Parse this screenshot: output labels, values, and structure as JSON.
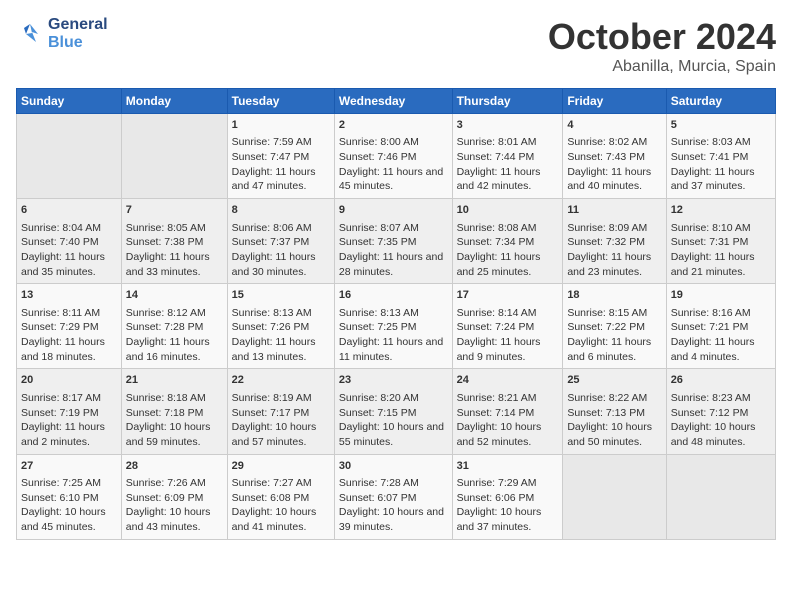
{
  "header": {
    "logo_line1": "General",
    "logo_line2": "Blue",
    "month": "October 2024",
    "location": "Abanilla, Murcia, Spain"
  },
  "days_of_week": [
    "Sunday",
    "Monday",
    "Tuesday",
    "Wednesday",
    "Thursday",
    "Friday",
    "Saturday"
  ],
  "weeks": [
    [
      {
        "day": "",
        "info": ""
      },
      {
        "day": "",
        "info": ""
      },
      {
        "day": "1",
        "info": "Sunrise: 7:59 AM\nSunset: 7:47 PM\nDaylight: 11 hours and 47 minutes."
      },
      {
        "day": "2",
        "info": "Sunrise: 8:00 AM\nSunset: 7:46 PM\nDaylight: 11 hours and 45 minutes."
      },
      {
        "day": "3",
        "info": "Sunrise: 8:01 AM\nSunset: 7:44 PM\nDaylight: 11 hours and 42 minutes."
      },
      {
        "day": "4",
        "info": "Sunrise: 8:02 AM\nSunset: 7:43 PM\nDaylight: 11 hours and 40 minutes."
      },
      {
        "day": "5",
        "info": "Sunrise: 8:03 AM\nSunset: 7:41 PM\nDaylight: 11 hours and 37 minutes."
      }
    ],
    [
      {
        "day": "6",
        "info": "Sunrise: 8:04 AM\nSunset: 7:40 PM\nDaylight: 11 hours and 35 minutes."
      },
      {
        "day": "7",
        "info": "Sunrise: 8:05 AM\nSunset: 7:38 PM\nDaylight: 11 hours and 33 minutes."
      },
      {
        "day": "8",
        "info": "Sunrise: 8:06 AM\nSunset: 7:37 PM\nDaylight: 11 hours and 30 minutes."
      },
      {
        "day": "9",
        "info": "Sunrise: 8:07 AM\nSunset: 7:35 PM\nDaylight: 11 hours and 28 minutes."
      },
      {
        "day": "10",
        "info": "Sunrise: 8:08 AM\nSunset: 7:34 PM\nDaylight: 11 hours and 25 minutes."
      },
      {
        "day": "11",
        "info": "Sunrise: 8:09 AM\nSunset: 7:32 PM\nDaylight: 11 hours and 23 minutes."
      },
      {
        "day": "12",
        "info": "Sunrise: 8:10 AM\nSunset: 7:31 PM\nDaylight: 11 hours and 21 minutes."
      }
    ],
    [
      {
        "day": "13",
        "info": "Sunrise: 8:11 AM\nSunset: 7:29 PM\nDaylight: 11 hours and 18 minutes."
      },
      {
        "day": "14",
        "info": "Sunrise: 8:12 AM\nSunset: 7:28 PM\nDaylight: 11 hours and 16 minutes."
      },
      {
        "day": "15",
        "info": "Sunrise: 8:13 AM\nSunset: 7:26 PM\nDaylight: 11 hours and 13 minutes."
      },
      {
        "day": "16",
        "info": "Sunrise: 8:13 AM\nSunset: 7:25 PM\nDaylight: 11 hours and 11 minutes."
      },
      {
        "day": "17",
        "info": "Sunrise: 8:14 AM\nSunset: 7:24 PM\nDaylight: 11 hours and 9 minutes."
      },
      {
        "day": "18",
        "info": "Sunrise: 8:15 AM\nSunset: 7:22 PM\nDaylight: 11 hours and 6 minutes."
      },
      {
        "day": "19",
        "info": "Sunrise: 8:16 AM\nSunset: 7:21 PM\nDaylight: 11 hours and 4 minutes."
      }
    ],
    [
      {
        "day": "20",
        "info": "Sunrise: 8:17 AM\nSunset: 7:19 PM\nDaylight: 11 hours and 2 minutes."
      },
      {
        "day": "21",
        "info": "Sunrise: 8:18 AM\nSunset: 7:18 PM\nDaylight: 10 hours and 59 minutes."
      },
      {
        "day": "22",
        "info": "Sunrise: 8:19 AM\nSunset: 7:17 PM\nDaylight: 10 hours and 57 minutes."
      },
      {
        "day": "23",
        "info": "Sunrise: 8:20 AM\nSunset: 7:15 PM\nDaylight: 10 hours and 55 minutes."
      },
      {
        "day": "24",
        "info": "Sunrise: 8:21 AM\nSunset: 7:14 PM\nDaylight: 10 hours and 52 minutes."
      },
      {
        "day": "25",
        "info": "Sunrise: 8:22 AM\nSunset: 7:13 PM\nDaylight: 10 hours and 50 minutes."
      },
      {
        "day": "26",
        "info": "Sunrise: 8:23 AM\nSunset: 7:12 PM\nDaylight: 10 hours and 48 minutes."
      }
    ],
    [
      {
        "day": "27",
        "info": "Sunrise: 7:25 AM\nSunset: 6:10 PM\nDaylight: 10 hours and 45 minutes."
      },
      {
        "day": "28",
        "info": "Sunrise: 7:26 AM\nSunset: 6:09 PM\nDaylight: 10 hours and 43 minutes."
      },
      {
        "day": "29",
        "info": "Sunrise: 7:27 AM\nSunset: 6:08 PM\nDaylight: 10 hours and 41 minutes."
      },
      {
        "day": "30",
        "info": "Sunrise: 7:28 AM\nSunset: 6:07 PM\nDaylight: 10 hours and 39 minutes."
      },
      {
        "day": "31",
        "info": "Sunrise: 7:29 AM\nSunset: 6:06 PM\nDaylight: 10 hours and 37 minutes."
      },
      {
        "day": "",
        "info": ""
      },
      {
        "day": "",
        "info": ""
      }
    ]
  ]
}
